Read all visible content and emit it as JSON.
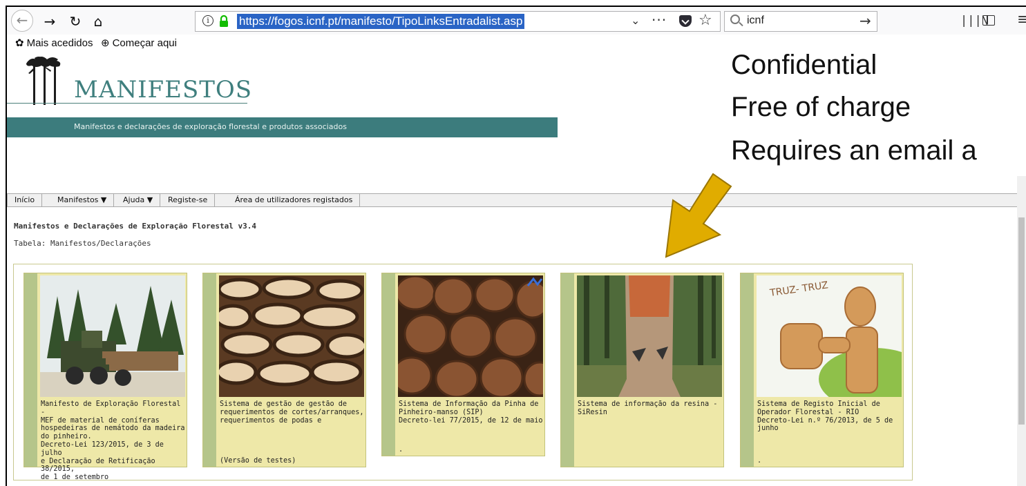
{
  "browser": {
    "url": "https://fogos.icnf.pt/manifesto/TipoLinksEntradalist.asp",
    "search_value": "icnf",
    "bookmarks": [
      {
        "label": "Mais acedidos",
        "icon": "gear-icon"
      },
      {
        "label": "Começar aqui",
        "icon": "globe-icon"
      }
    ]
  },
  "site": {
    "logo_title": "MANIFESTOS",
    "banner_text": "Manifestos e declarações de exploração florestal e produtos associados",
    "menu": [
      {
        "label": "Início"
      },
      {
        "label": "Manifestos ▼"
      },
      {
        "label": "Ajuda ▼"
      },
      {
        "label": "Registe-se"
      },
      {
        "label": "Área de utilizadores registados"
      }
    ],
    "page_title": "Manifestos e Declarações de Exploração Florestal v3.4",
    "page_subtitle": "Tabela: Manifestos/Declarações"
  },
  "cards": [
    {
      "text": "Manifesto de Exploração Florestal -\nMEF de material de coníferas\nhospedeiras de nemátodo da madeira\ndo pinheiro.\nDecreto-Lei 123/2015, de 3 de julho\ne Declaração de Retificação 38/2015,\nde 1 de setembro",
      "footer": ""
    },
    {
      "text": "Sistema de gestão de gestão de\nrequerimentos de cortes/arranques,\nrequerimentos de podas e",
      "footer": "(Versão de testes)"
    },
    {
      "text": "Sistema de Informação da Pinha de\nPinheiro-manso (SIP)\nDecreto-lei 77/2015, de 12 de maio",
      "footer": "."
    },
    {
      "text": "Sistema de informação da resina -\nSiResin",
      "footer": ""
    },
    {
      "text": "Sistema de Registo Inicial de\nOperador Florestal - RIO\nDecreto-Lei n.º 76/2013, de 5 de\njunho",
      "footer": "."
    }
  ],
  "card_image_text": {
    "truz": "TRUZ-\nTRUZ"
  },
  "annotation": {
    "lines": [
      "Confidential",
      "Free of charge",
      "Requires an email a"
    ],
    "arrow_color": "#e0ac00"
  },
  "colors": {
    "banner": "#3c7c7d",
    "card_bg": "#eee8a8",
    "card_strip": "#b5c58a"
  }
}
